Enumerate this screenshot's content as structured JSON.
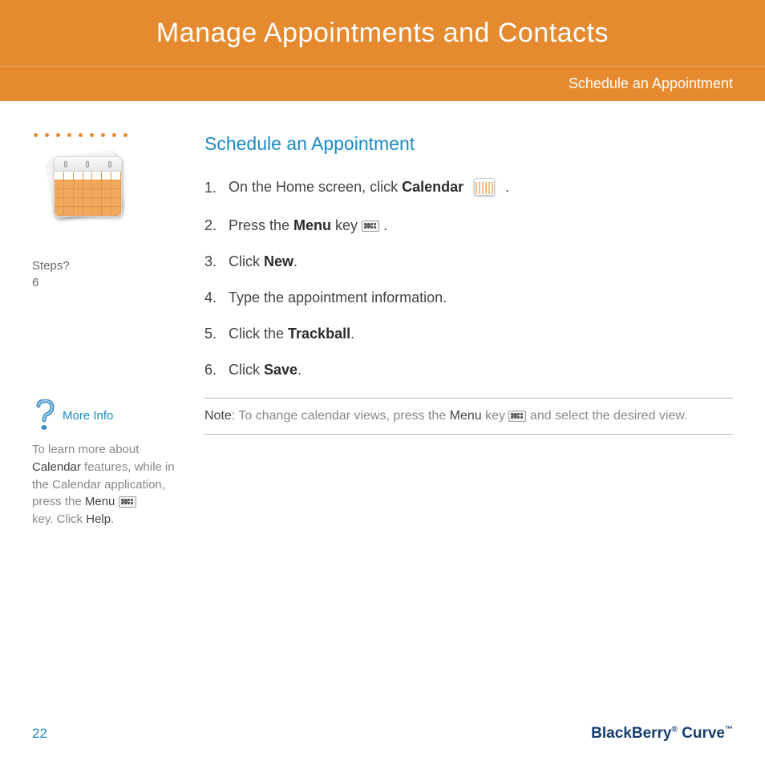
{
  "header": {
    "title": "Manage Appointments and Contacts",
    "subtitle": "Schedule an Appointment"
  },
  "sidebar": {
    "steps_label": "Steps?",
    "steps_count": "6",
    "more_info_label": "More Info",
    "info_pre": "To learn more about ",
    "info_cal": "Calendar",
    "info_mid": " features, while in the Calendar application,  press the ",
    "info_menu": "Menu",
    "info_post1": " ",
    "info_post2": "key. Click ",
    "info_help": "Help",
    "info_end": "."
  },
  "main": {
    "heading": "Schedule an Appointment",
    "steps": [
      {
        "num": "1.",
        "pre": "On the Home screen, click ",
        "bold": "Calendar",
        "post": " ",
        "icon": "calendar",
        "tail": " ."
      },
      {
        "num": "2.",
        "pre": "Press the ",
        "bold": "Menu",
        "post": " key ",
        "icon": "menu",
        "tail": " ."
      },
      {
        "num": "3.",
        "pre": "Click ",
        "bold": "New",
        "post": ".",
        "icon": "",
        "tail": ""
      },
      {
        "num": "4.",
        "pre": "Type the appointment information.",
        "bold": "",
        "post": "",
        "icon": "",
        "tail": ""
      },
      {
        "num": "5.",
        "pre": "Click the ",
        "bold": "Trackball",
        "post": ".",
        "icon": "",
        "tail": ""
      },
      {
        "num": "6.",
        "pre": "Click ",
        "bold": "Save",
        "post": ".",
        "icon": "",
        "tail": ""
      }
    ],
    "note": {
      "label": "Note",
      "pre": ": To change calendar views, press the ",
      "bold": "Menu",
      "mid": " key ",
      "post": " and select the desired view."
    }
  },
  "footer": {
    "page": "22",
    "brand_a": "BlackBerry",
    "brand_r": "®",
    "brand_b": " Curve",
    "brand_tm": "™"
  }
}
